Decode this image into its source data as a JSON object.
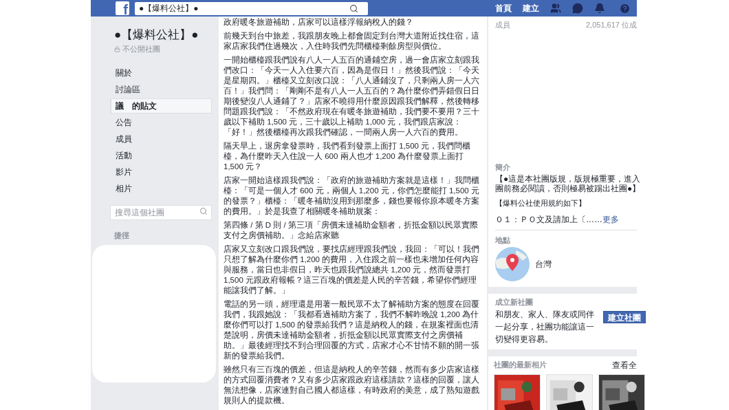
{
  "topbar": {
    "logo": "f",
    "search_value": "●【爆料公社】●",
    "links": [
      "首頁",
      "建立"
    ]
  },
  "group": {
    "name": "●【爆料公社】●",
    "privacy": "不公開社團"
  },
  "nav": [
    {
      "label": "關於",
      "selected": false
    },
    {
      "label": "討論區",
      "selected": false
    },
    {
      "label": "議　的貼文",
      "selected": true
    },
    {
      "label": "公告",
      "selected": false
    },
    {
      "label": "成員",
      "selected": false
    },
    {
      "label": "活動",
      "selected": false
    },
    {
      "label": "影片",
      "selected": false
    },
    {
      "label": "相片",
      "selected": false
    }
  ],
  "group_search": {
    "placeholder": "搜尋這個社團"
  },
  "shortcuts_heading": "捷徑",
  "post": {
    "paragraphs": [
      [
        "政府暖冬旅遊補助，店家可以這樣浮報納稅人的錢？"
      ],
      [
        "前幾天到台中旅差，我跟朋友晚上都會固定到台灣大道附近找住宿，這",
        "家店家我們住過幾次，入住時我們先問櫃檯剩餘房型與價位。"
      ],
      [
        "一開始櫃檯跟我們說有八人一人五百的通鋪空房，過一會店家立刻跟我",
        "們改口：「今天一人入住要六百，因為是假日！」然後我們說：「今天",
        "是星期四。」櫃檯又立刻改口說：「八人通鋪沒了，只剩兩人房一人六",
        "百！」我們問：「剛剛不是有八人一人五百的？為什麼你們弄錯假日日",
        "期後變沒八人通鋪了？」店家不曉得用什麼原因跟我們解釋，然後轉移",
        "問題跟我們說：「不然政府現在有暖冬旅遊補助，我們要不要用？三十",
        "歲以下補助 1,500 元，三十歲以上補助 1,000 元，我們跟店家說：",
        "「好！」然後櫃檯再次跟我們確認，一間兩人房一人六百的費用。"
      ],
      [
        "隔天早上，退房拿發票時，我們看到發票上面打 1,500 元，我們問櫃",
        "檯，為什麼昨天入住說一人 600 兩人也才 1,200 為什麼發票上面打",
        "1,500 元？"
      ],
      [
        "店家一開始這樣跟我們說：「政府的旅遊補助方案就是這樣！」我問櫃",
        "檯：「可是一個人才 600 元，兩個人 1,200 元，你們怎麼能打 1,500 元",
        "的發票？」櫃檯：「暖冬補助沒用到那麼多，錢也要報你原本暖冬方案",
        "的費用。」於是我查了相關暖冬補助規案："
      ],
      [
        "第四條 / 第 D 則 / 第三項「房價未達補助金額者，折抵金額以民眾實際",
        "支付之房價補助。」念給店家聽"
      ],
      [
        "店家又立刻改口跟我們說，要找店經理跟我們說，我回：「可以！我們",
        "只想了解為什麼你們 1,200 的費用，入住跟之前一樣也未增加任何內容",
        "與服務，當日也非假日，昨天也跟我們說總共 1,200 元，然而發票打",
        "1,500 元跟政府報帳？這三百塊的價差是人民的辛苦錢，希望你們經理",
        "能讓我們了解。」"
      ],
      [
        "電話的另一頭，經理還是用著一般民眾不太了解補助方案的態度在回覆",
        "我們，我跟她說：「我都看過補助方案了，我們不解昨晚說 1,200 為什",
        "麼你們可以打 1,500 的發票給我們？這是納稅人的錢，在規案裡面也清",
        "楚說明，房價未達補助金額者，折抵金額以民眾實際支付之房價補",
        "助。」最後經理找不到合理回覆的方式，店家才心不甘情不願的開一張",
        "新的發票給我們。"
      ],
      [
        "雖然只有三百塊的價差，但這是納稅人的辛苦錢，然而有多少店家這樣",
        "的方式回覆消費者？又有多少店家跟政府這樣請款？這樣的回覆，讓人",
        "無法想像，店家連對自己國人都這樣，有時政府的美意，成了熟知遊戲",
        "規則人的提款機。"
      ]
    ]
  },
  "members": {
    "label": "成員",
    "count": "2,051,617 位成"
  },
  "about": {
    "heading": "簡介",
    "lines": [
      "【●這是本社團版規，版規極重要，進入",
      "團前務必閱讀，否則極易被踢出社團●】"
    ],
    "rules_title": "【爆料公社使用規約如下】",
    "excerpt": "０１：ＰＯ文及請加上〔……",
    "more": "更多"
  },
  "location": {
    "heading": "地點",
    "place": "台灣"
  },
  "create_group": {
    "heading": "成立新社團",
    "lines": [
      "和朋友、家人、隊友或同伴",
      "一起分享，社團功能讓這一",
      "切變得更容易。"
    ],
    "button": "建立社團"
  },
  "photos": {
    "heading": "社團的最新相片",
    "see_all": "查看全"
  }
}
